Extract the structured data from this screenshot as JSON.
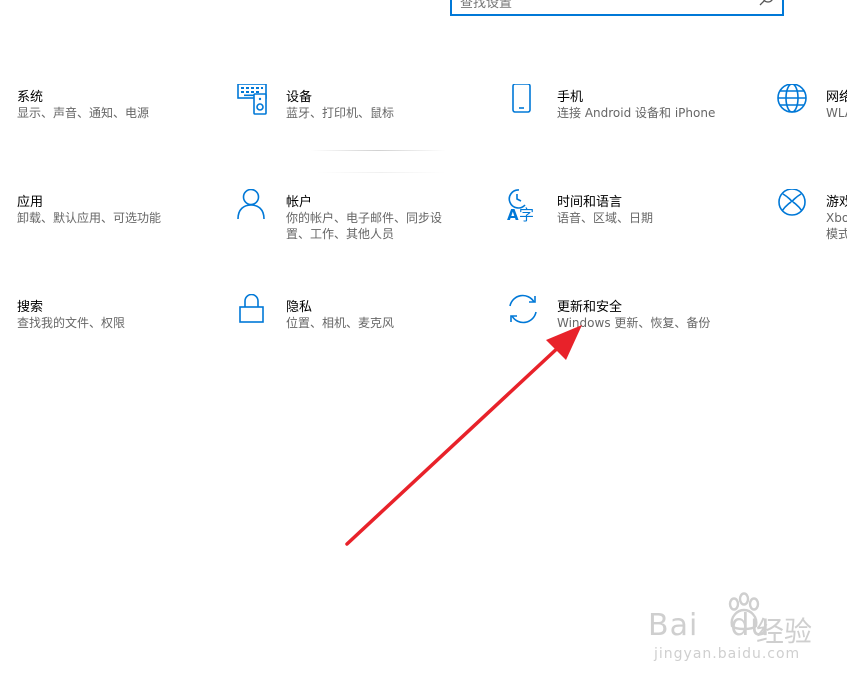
{
  "search": {
    "placeholder": "查找设置"
  },
  "tiles": [
    {
      "title": "系统",
      "desc": "显示、声音、通知、电源"
    },
    {
      "title": "设备",
      "desc": "蓝牙、打印机、鼠标"
    },
    {
      "title": "手机",
      "desc": "连接 Android 设备和 iPhone"
    },
    {
      "title": "网络",
      "desc": "WLA"
    },
    {
      "title": "应用",
      "desc": "卸载、默认应用、可选功能"
    },
    {
      "title": "帐户",
      "desc": "你的帐户、电子邮件、同步设\n置、工作、其他人员"
    },
    {
      "title": "时间和语言",
      "desc": "语音、区域、日期"
    },
    {
      "title": "游戏",
      "desc": "Xbo\n模式"
    },
    {
      "title": "搜索",
      "desc": "查找我的文件、权限"
    },
    {
      "title": "隐私",
      "desc": "位置、相机、麦克风"
    },
    {
      "title": "更新和安全",
      "desc": "Windows 更新、恢复、备份"
    }
  ],
  "watermark": {
    "logo": "Bai",
    "logo2": "du",
    "jingyan": "经验",
    "url": "jingyan.baidu.com"
  },
  "colors": {
    "accent": "#0078d7",
    "arrow": "#e8222a"
  }
}
